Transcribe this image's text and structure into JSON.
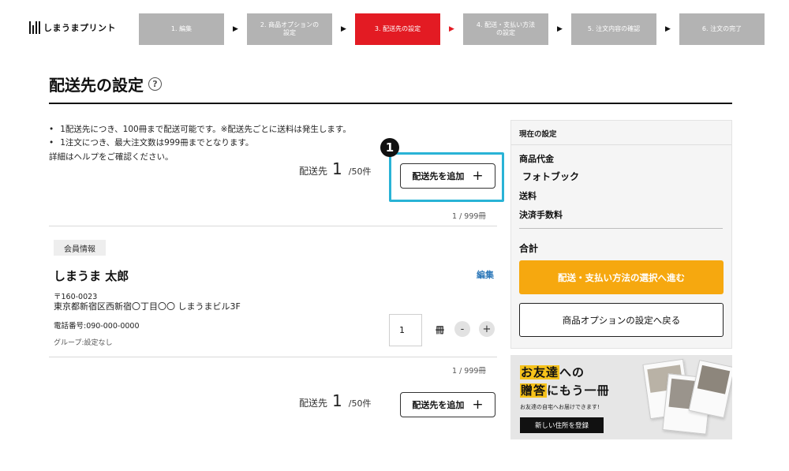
{
  "header": {
    "logo_text": "しまうまプリント",
    "steps": [
      {
        "label": "1. 編集",
        "active": false
      },
      {
        "label": "2. 商品オプションの\n設定",
        "active": false
      },
      {
        "label": "3. 配送先の設定",
        "active": true
      },
      {
        "label": "4. 配送・支払い方法\nの設定",
        "active": false
      },
      {
        "label": "5. 注文内容の確認",
        "active": false
      },
      {
        "label": "6. 注文の完了",
        "active": false
      }
    ],
    "arrow": "▶"
  },
  "page": {
    "title": "配送先の設定",
    "help_icon": "?"
  },
  "notes": {
    "bullets": [
      "1配送先につき、100冊まで配送可能です。※配送先ごとに送料は発生します。",
      "1注文につき、最大注文数は999冊までとなります。"
    ],
    "help_text": "詳細はヘルプをご確認ください。"
  },
  "annotation": {
    "badge": "1"
  },
  "destinations": {
    "label": "配送先",
    "count": "1",
    "max": "/50件",
    "add_label": "配送先を追加",
    "add_icon": "+",
    "volume": "1 / 999冊"
  },
  "member": {
    "tag": "会員情報",
    "name": "しまうま 太郎",
    "edit": "編集",
    "postal": "〒160-0023",
    "address": "東京都新宿区西新宿〇丁目〇〇 しまうまビル3F",
    "phone": "電話番号:090-000-0000",
    "group": "グループ:設定なし",
    "quantity": "1",
    "unit": "冊",
    "minus": "-",
    "plus": "+"
  },
  "summary": {
    "heading": "現在の設定",
    "product_cost": "商品代金",
    "product_name": "フォトブック",
    "shipping": "送料",
    "fee": "決済手数料",
    "total": "合計",
    "next_button": "配送・支払い方法の選択へ進む",
    "back_button": "商品オプションの設定へ戻る"
  },
  "banner": {
    "line1_hl": "お友達",
    "line1_rest": "への",
    "line2_hl": "贈答",
    "line2_rest": "にもう一冊",
    "sub": "お友達の自宅へお届けできます!",
    "button": "新しい住所を登録"
  },
  "colors": {
    "accent_red": "#e31b23",
    "step_gray": "#b3b3b3",
    "cta_orange": "#f6a80f",
    "highlight_cyan": "#29b3d6",
    "link_blue": "#2d78b9",
    "banner_yellow": "#f6c21a"
  }
}
